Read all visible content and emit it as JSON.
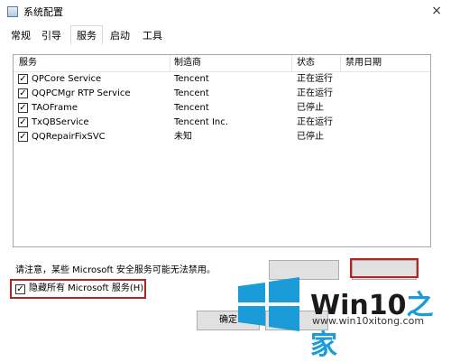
{
  "window": {
    "title": "系统配置",
    "close_glyph": "×"
  },
  "tabs": [
    {
      "label": "常规"
    },
    {
      "label": "引导"
    },
    {
      "label": "服务",
      "active": true
    },
    {
      "label": "启动"
    },
    {
      "label": "工具"
    }
  ],
  "list": {
    "headers": [
      "服务",
      "制造商",
      "状态",
      "禁用日期"
    ],
    "rows": [
      {
        "checked": true,
        "service": "QPCore Service",
        "vendor": "Tencent",
        "status": "正在运行"
      },
      {
        "checked": true,
        "service": "QQPCMgr RTP Service",
        "vendor": "Tencent",
        "status": "正在运行"
      },
      {
        "checked": true,
        "service": "TAOFrame",
        "vendor": "Tencent",
        "status": "已停止"
      },
      {
        "checked": true,
        "service": "TxQBService",
        "vendor": "Tencent Inc.",
        "status": "正在运行"
      },
      {
        "checked": true,
        "service": "QQRepairFixSVC",
        "vendor": "未知",
        "status": "已停止"
      }
    ],
    "check_glyph": "✓"
  },
  "note": "请注意，某些 Microsoft 安全服务可能无法禁用。",
  "hide_ms": {
    "checked": true,
    "label": "隐藏所有 Microsoft 服务(H)"
  },
  "buttons": {
    "ok": "确定"
  },
  "watermark": {
    "brand_a": "Win10",
    "brand_b": "之家",
    "url": "www.win10xitong.com",
    "accent": "#1b9bd7"
  }
}
